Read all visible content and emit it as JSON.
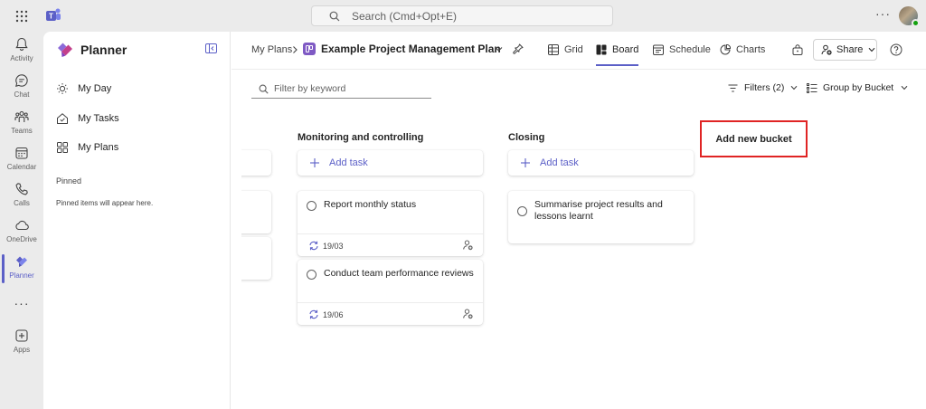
{
  "search": {
    "placeholder": "Search (Cmd+Opt+E)"
  },
  "rail": [
    {
      "label": "Activity",
      "icon": "bell-icon"
    },
    {
      "label": "Chat",
      "icon": "chat-icon"
    },
    {
      "label": "Teams",
      "icon": "teams-icon"
    },
    {
      "label": "Calendar",
      "icon": "calendar-icon"
    },
    {
      "label": "Calls",
      "icon": "phone-icon"
    },
    {
      "label": "OneDrive",
      "icon": "cloud-icon"
    },
    {
      "label": "Planner",
      "icon": "planner-icon",
      "active": true
    },
    {
      "label": "Apps",
      "icon": "add-apps-icon"
    }
  ],
  "sidenav": {
    "app_name": "Planner",
    "items": [
      {
        "label": "My Day",
        "icon": "sun-icon"
      },
      {
        "label": "My Tasks",
        "icon": "home-check-icon"
      },
      {
        "label": "My Plans",
        "icon": "grid-icon"
      }
    ],
    "pinned_heading": "Pinned",
    "pinned_empty": "Pinned items will appear here."
  },
  "header": {
    "breadcrumb": "My Plans",
    "plan_title": "Example Project Management Plan",
    "tabs": [
      {
        "label": "Grid",
        "icon": "table-icon"
      },
      {
        "label": "Board",
        "icon": "board-icon",
        "active": true
      },
      {
        "label": "Schedule",
        "icon": "calendar-icon"
      },
      {
        "label": "Charts",
        "icon": "chart-icon"
      }
    ],
    "share_label": "Share"
  },
  "toolbar": {
    "filter_placeholder": "Filter by keyword",
    "filters_label": "Filters (2)",
    "group_label": "Group by Bucket"
  },
  "board": {
    "buckets": [
      {
        "name": "Monitoring and controlling",
        "add_task_label": "Add task",
        "tasks": [
          {
            "title": "Report monthly status",
            "date": "19/03",
            "recurring": true
          },
          {
            "title": "Conduct team performance reviews",
            "date": "19/06",
            "recurring": true
          }
        ]
      },
      {
        "name": "Closing",
        "add_task_label": "Add task",
        "tasks": [
          {
            "title": "Summarise project results and lessons learnt"
          }
        ]
      }
    ],
    "add_bucket_label": "Add new bucket"
  },
  "colors": {
    "accent": "#5b5fc7",
    "highlight": "#e02424",
    "planner_purple": "#7f5ac4"
  }
}
